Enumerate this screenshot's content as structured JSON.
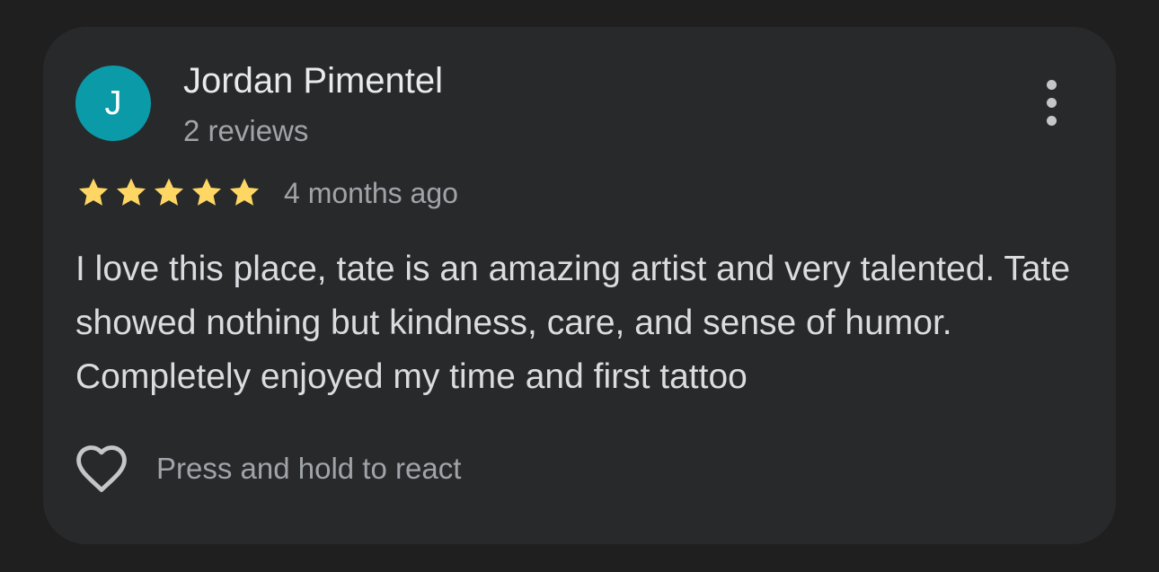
{
  "review": {
    "avatar_initial": "J",
    "author_name": "Jordan Pimentel",
    "review_count": "2 reviews",
    "rating": 5,
    "rating_max": 5,
    "time": "4 months ago",
    "text": "I love this place, tate is an amazing artist and very talented. Tate showed nothing but kindness, care, and sense of humor. Completely enjoyed my time and first tattoo",
    "react_label": "Press and hold to react"
  },
  "icons": {
    "more": "more-vert-icon",
    "star": "star-icon",
    "react": "heart-outline-icon"
  },
  "colors": {
    "background": "#1f1f1f",
    "card": "#28292b",
    "avatar": "#0a9aa8",
    "star": "#fdd663",
    "primary_text": "#e8eaed",
    "secondary_text": "#a0a4a8"
  }
}
